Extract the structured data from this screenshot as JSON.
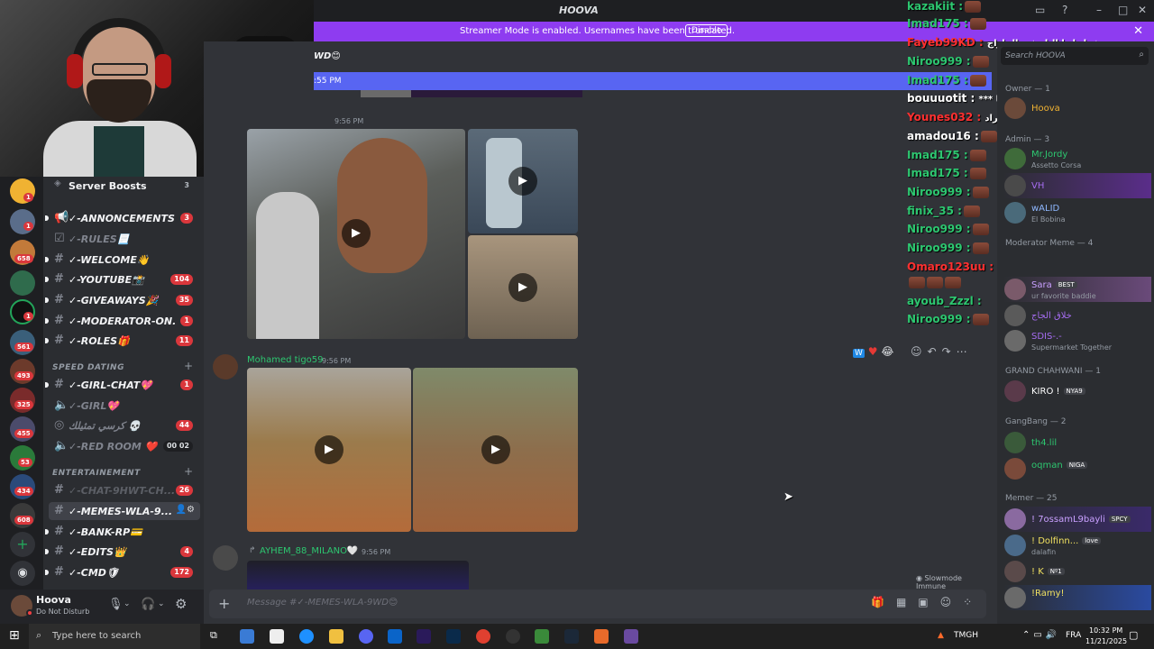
{
  "window": {
    "title": "HOOVA"
  },
  "banner": {
    "message": "Streamer Mode is enabled. Usernames have been truncated.",
    "disable_label": "Disable"
  },
  "server": {
    "boosts_label": "Server Boosts",
    "boosts_count": "3",
    "channels": [
      {
        "name": "✓-ANNONCEMENTS...",
        "count": "3"
      },
      {
        "name": "✓-RULES📃",
        "count": ""
      },
      {
        "name": "✓-WELCOME👋",
        "count": ""
      },
      {
        "name": "✓-YOUTUBE📸",
        "count": "104"
      },
      {
        "name": "✓-GIVEAWAYS🎉",
        "count": "35"
      },
      {
        "name": "✓-MODERATOR-ON...",
        "count": "1"
      },
      {
        "name": "✓-ROLES🎁",
        "count": "11"
      }
    ],
    "category_speed": "SPEED DATING",
    "speed_channels": [
      {
        "name": "✓-GIRL-CHAT💖",
        "count": "1"
      },
      {
        "name": "✓-GIRL💖",
        "count": ""
      },
      {
        "name": "كرسي تمثيلك 💀",
        "count": "44"
      },
      {
        "name": "✓-RED ROOM ❤️",
        "count": "00 02"
      }
    ],
    "category_ent": "ENTERTAINEMENT",
    "ent_channels": [
      {
        "name": "✓-CHAT-9HWT-CH...",
        "count": "26"
      },
      {
        "name": "✓-MEMES-WLA-9...",
        "count": ""
      },
      {
        "name": "✓-BANK-RP💳",
        "count": ""
      },
      {
        "name": "✓-EDITS👑",
        "count": "4"
      },
      {
        "name": "✓-CMD🛡",
        "count": "172"
      }
    ]
  },
  "rail_badges": [
    "1",
    "1",
    "658",
    "",
    "1",
    "561",
    "493",
    "325",
    "455",
    "53",
    "434",
    "608"
  ],
  "user": {
    "name": "Hoova",
    "status": "Do Not Disturb"
  },
  "chat": {
    "channel_title": "WD😊",
    "highlight_time": ":55 PM",
    "msg1_time": "9:56 PM",
    "msg2_user": "Mohamed tigo59",
    "msg2_time": "9:56 PM",
    "msg3_user": "AYHEM_88_MILANO🤍",
    "msg3_time": "9:56 PM",
    "slowmode": "Slowmode Immune",
    "composer_placeholder": "Message #✓-MEMES-WLA-9WD😊"
  },
  "overlay": [
    {
      "user": "kazakiit :",
      "color": "#2dc770"
    },
    {
      "user": "Imad175 :",
      "color": "#2dc770"
    },
    {
      "user": "Fayeb99KD :",
      "color": "#ff3030",
      "text": "شعل لينا النار في الجاراج"
    },
    {
      "user": "Niroo999 :",
      "color": "#2dc770"
    },
    {
      "user": "Imad175 :",
      "color": "#2dc770"
    },
    {
      "user": "bouuuotit :",
      "color": "#ffffff",
      "text": "*** نفس يا"
    },
    {
      "user": "Younes032 :",
      "color": "#ff3030",
      "text": "طلعنا في غراد"
    },
    {
      "user": "amadou16 :",
      "color": "#ffffff"
    },
    {
      "user": "Imad175 :",
      "color": "#2dc770"
    },
    {
      "user": "Imad175 :",
      "color": "#2dc770"
    },
    {
      "user": "Niroo999 :",
      "color": "#2dc770"
    },
    {
      "user": "finix_35 :",
      "color": "#2dc770"
    },
    {
      "user": "Niroo999 :",
      "color": "#2dc770"
    },
    {
      "user": "Niroo999 :",
      "color": "#2dc770"
    },
    {
      "user": "Omaro123uu :",
      "color": "#ff3030"
    },
    {
      "user": "ayoub_Zzzl :",
      "color": "#2dc770"
    },
    {
      "user": "Niroo999 :",
      "color": "#2dc770"
    }
  ],
  "members": {
    "search_placeholder": "Search HOOVA",
    "owner_header": "Owner — 1",
    "owner": {
      "name": "Hoova"
    },
    "admin_header": "Admin — 3",
    "admins": [
      {
        "name": "Mr.Jordy",
        "status": "Assetto Corsa"
      },
      {
        "name": "VH",
        "status": ""
      },
      {
        "name": "wALID",
        "status": "El Bobina"
      }
    ],
    "mod_header": "Moderator Meme — 4",
    "mods": [
      {
        "name": "Sara",
        "tag": "BEST",
        "status": "ur favorite baddie"
      },
      {
        "name": "خلاق الجاج",
        "status": ""
      },
      {
        "name": "SDIS-.-",
        "status": "Supermarket Together"
      }
    ],
    "gc_header": "GRAND CHAHWANI — 1",
    "gc": {
      "name": "KIRO !",
      "tag": "NYA9"
    },
    "gb_header": "GangBang — 2",
    "gb": [
      {
        "name": "th4.lil",
        "tag": ""
      },
      {
        "name": "oqman",
        "tag": "NIGA"
      }
    ],
    "memer_header": "Memer — 25",
    "memers": [
      {
        "name": "! 7ossamL9bayli",
        "tag": "SPCY"
      },
      {
        "name": "! Dolfinn...",
        "tag": "love",
        "status": "dalafin"
      },
      {
        "name": "! K",
        "tag": "Nº1"
      },
      {
        "name": "!Ramy!",
        "tag": ""
      }
    ]
  },
  "taskbar": {
    "search_placeholder": "Type here to search",
    "ticker": "TMGH",
    "lang": "FRA",
    "time": "10:32 PM",
    "date": "11/21/2025"
  }
}
